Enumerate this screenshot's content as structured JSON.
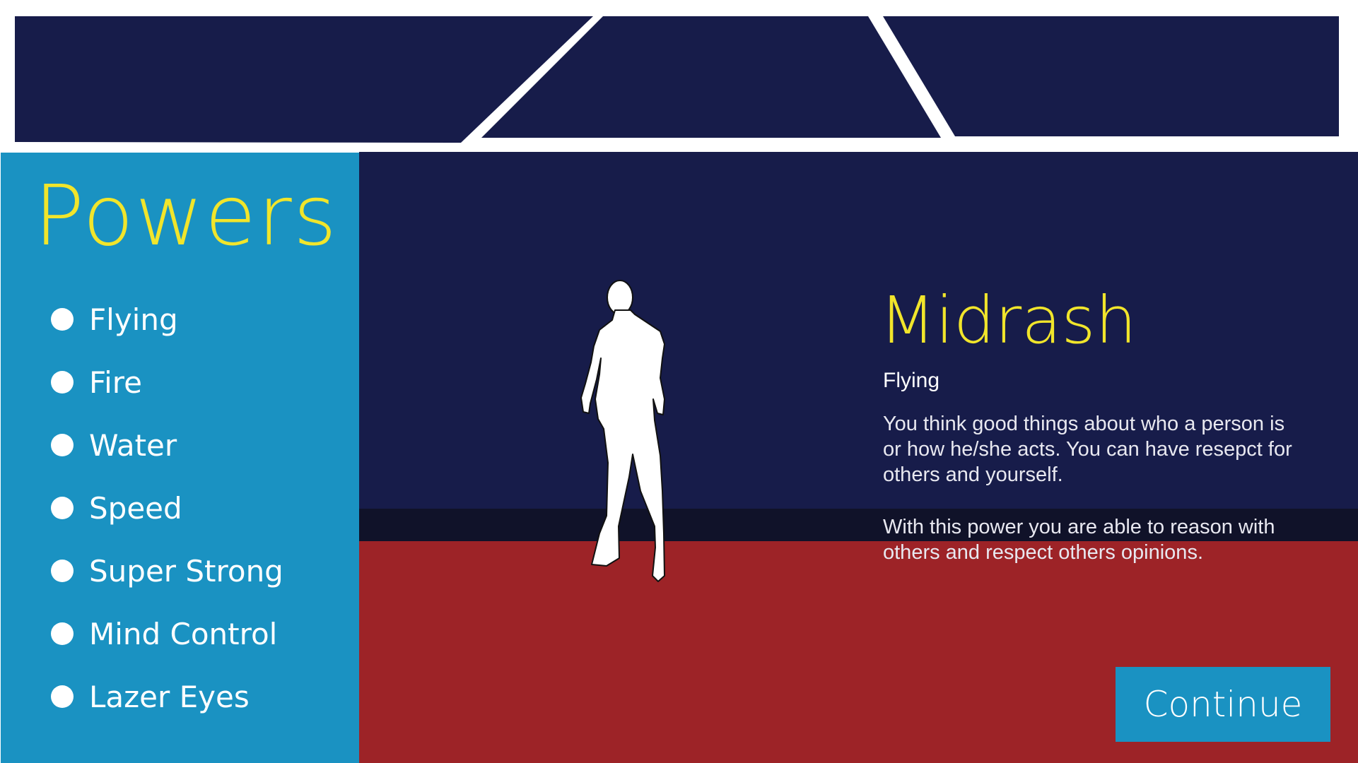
{
  "sidebar": {
    "title": "Powers",
    "items": [
      {
        "label": "Flying"
      },
      {
        "label": "Fire"
      },
      {
        "label": "Water"
      },
      {
        "label": "Speed"
      },
      {
        "label": "Super Strong"
      },
      {
        "label": "Mind Control"
      },
      {
        "label": "Lazer Eyes"
      }
    ]
  },
  "hero": {
    "name": "Midrash",
    "power": "Flying",
    "description": [
      "You think good things about who a person is or how he/she acts. You can have resepct for others and yourself.",
      "With this power you are able to reason with others and respect others opinions."
    ]
  },
  "continue_button": {
    "label": "Continue"
  },
  "colors": {
    "navy": "#171c4a",
    "sidebar_blue": "#1a92c2",
    "title_yellow": "#f1e52b",
    "floor_red": "#9d2327"
  }
}
